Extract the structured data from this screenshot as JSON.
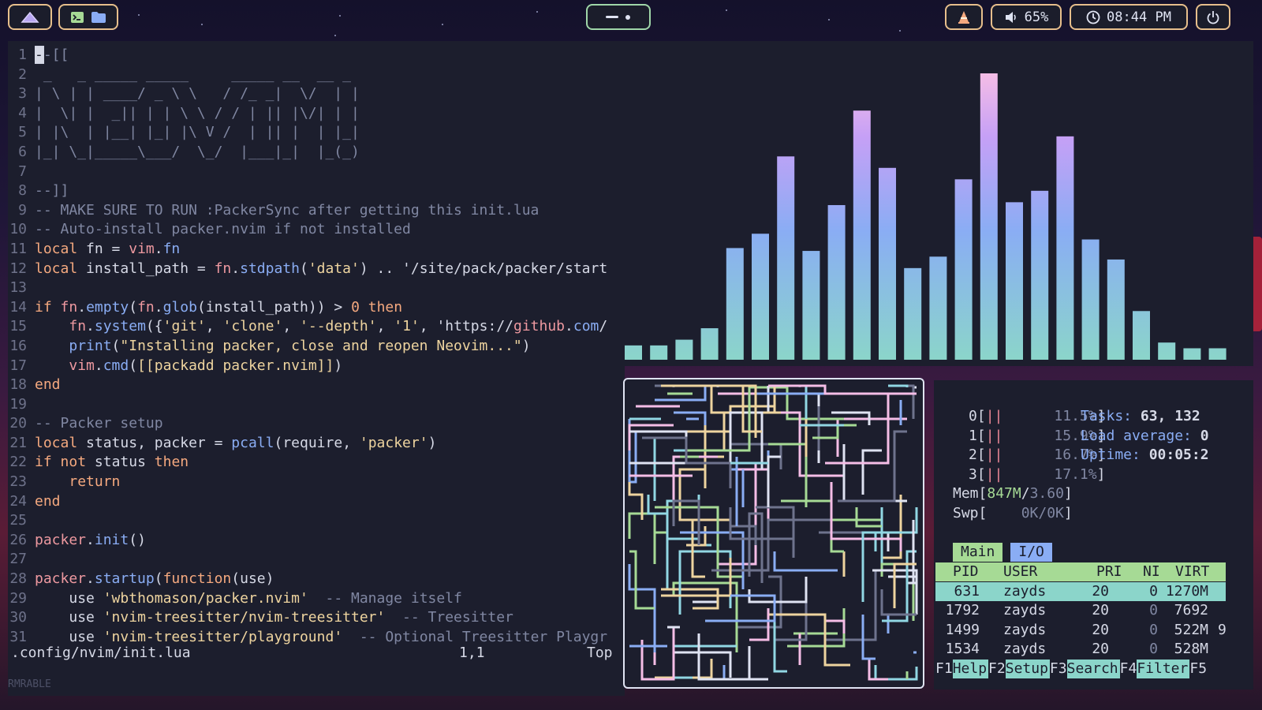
{
  "topbar": {
    "workspace_icon": "mountain-icon",
    "launcher_icons": [
      "terminal-icon",
      "folder-icon"
    ],
    "center_icons": [
      "minus-icon",
      "dot-icon"
    ],
    "vlc_icon": "vlc-cone-icon",
    "volume": {
      "icon": "speaker-icon",
      "value": "65%"
    },
    "clock": {
      "icon": "clock-icon",
      "value": "08:44 PM"
    },
    "power_icon": "power-icon"
  },
  "editor": {
    "lines": [
      {
        "n": "1",
        "text": "--[["
      },
      {
        "n": "2",
        "text": " _   _ _____ _____     _____ __  __ _ "
      },
      {
        "n": "3",
        "text": "| \\ | | ____/ _ \\ \\   / /_ _|  \\/  | |"
      },
      {
        "n": "4",
        "text": "|  \\| |  _|| | | \\ \\ / / | || |\\/| | |"
      },
      {
        "n": "5",
        "text": "| |\\  | |__| |_| |\\ V /  | || |  | |_|"
      },
      {
        "n": "6",
        "text": "|_| \\_|_____\\___/  \\_/  |___|_|  |_(_)"
      },
      {
        "n": "7",
        "text": ""
      },
      {
        "n": "8",
        "text": "--]]"
      },
      {
        "n": "9",
        "text": "-- MAKE SURE TO RUN :PackerSync after getting this init.lua"
      },
      {
        "n": "10",
        "text": "-- Auto-install packer.nvim if not installed"
      },
      {
        "n": "11",
        "text": "local fn = vim.fn"
      },
      {
        "n": "12",
        "text": "local install_path = fn.stdpath('data') .. '/site/pack/packer/start"
      },
      {
        "n": "13",
        "text": ""
      },
      {
        "n": "14",
        "text": "if fn.empty(fn.glob(install_path)) > 0 then"
      },
      {
        "n": "15",
        "text": "    fn.system({'git', 'clone', '--depth', '1', 'https://github.com/"
      },
      {
        "n": "16",
        "text": "    print(\"Installing packer, close and reopen Neovim...\")"
      },
      {
        "n": "17",
        "text": "    vim.cmd([[packadd packer.nvim]])"
      },
      {
        "n": "18",
        "text": "end"
      },
      {
        "n": "19",
        "text": ""
      },
      {
        "n": "20",
        "text": "-- Packer setup"
      },
      {
        "n": "21",
        "text": "local status, packer = pcall(require, 'packer')"
      },
      {
        "n": "22",
        "text": "if not status then"
      },
      {
        "n": "23",
        "text": "    return"
      },
      {
        "n": "24",
        "text": "end"
      },
      {
        "n": "25",
        "text": ""
      },
      {
        "n": "26",
        "text": "packer.init()"
      },
      {
        "n": "27",
        "text": ""
      },
      {
        "n": "28",
        "text": "packer.startup(function(use)"
      },
      {
        "n": "29",
        "text": "    use 'wbthomason/packer.nvim'  -- Manage itself"
      },
      {
        "n": "30",
        "text": "    use 'nvim-treesitter/nvim-treesitter'  -- Treesitter"
      },
      {
        "n": "31",
        "text": "    use 'nvim-treesitter/playground'  -- Optional Treesitter Playgr"
      }
    ],
    "status": {
      "file": ".config/nvim/init.lua",
      "position": "1,1",
      "scroll": "Top"
    },
    "cmdline": "RMRABLE"
  },
  "visualizer": {
    "levels": [
      0.05,
      0.05,
      0.07,
      0.11,
      0.39,
      0.44,
      0.71,
      0.38,
      0.54,
      0.87,
      0.67,
      0.32,
      0.36,
      0.63,
      1.0,
      0.55,
      0.59,
      0.78,
      0.42,
      0.35,
      0.17,
      0.06,
      0.04,
      0.04
    ]
  },
  "htop": {
    "cpus": [
      {
        "id": "0[",
        "bar": "||",
        "pct": "11.5%]"
      },
      {
        "id": "1[",
        "bar": "||",
        "pct": "15.9%]"
      },
      {
        "id": "2[",
        "bar": "||",
        "pct": "16.7%]"
      },
      {
        "id": "3[",
        "bar": "||",
        "pct": "17.1%]"
      }
    ],
    "tasks_label": "Tasks:",
    "tasks_value": "63, 132",
    "load_label": "Load average:",
    "load_value": "0",
    "uptime_label": "Uptime:",
    "uptime_value": "00:05:2",
    "mem_label": "Mem[",
    "mem_value": "847M/3.60]",
    "swp_label": "Swp[",
    "swp_value": "0K/0K]",
    "tabs": [
      "Main",
      "I/O"
    ],
    "columns": [
      "PID",
      "USER",
      "PRI",
      "NI",
      "VIRT"
    ],
    "processes": [
      {
        "pid": "631",
        "user": "zayds",
        "pri": "20",
        "ni": "0",
        "virt": "1270M",
        "extra": ""
      },
      {
        "pid": "1792",
        "user": "zayds",
        "pri": "20",
        "ni": "0",
        "virt": "7692",
        "extra": ""
      },
      {
        "pid": "1499",
        "user": "zayds",
        "pri": "20",
        "ni": "0",
        "virt": "522M",
        "extra": "9"
      },
      {
        "pid": "1534",
        "user": "zayds",
        "pri": "20",
        "ni": "0",
        "virt": "528M",
        "extra": ""
      }
    ],
    "fkeys": [
      {
        "key": "F1",
        "label": "Help"
      },
      {
        "key": "F2",
        "label": "Setup"
      },
      {
        "key": "F3",
        "label": "Search"
      },
      {
        "key": "F4",
        "label": "Filter"
      },
      {
        "key": "F5",
        "label": ""
      }
    ]
  },
  "colors": {
    "accent": "#e7bf8c",
    "green_accent": "#9fd6a8",
    "htop_header": "#a6da95",
    "htop_selected": "#8bd5ca",
    "htop_tab_inactive": "#8aadf4",
    "bar_low": "#8bd5ca",
    "bar_mid": "#8aadf4",
    "bar_high": "#f5bde6"
  }
}
